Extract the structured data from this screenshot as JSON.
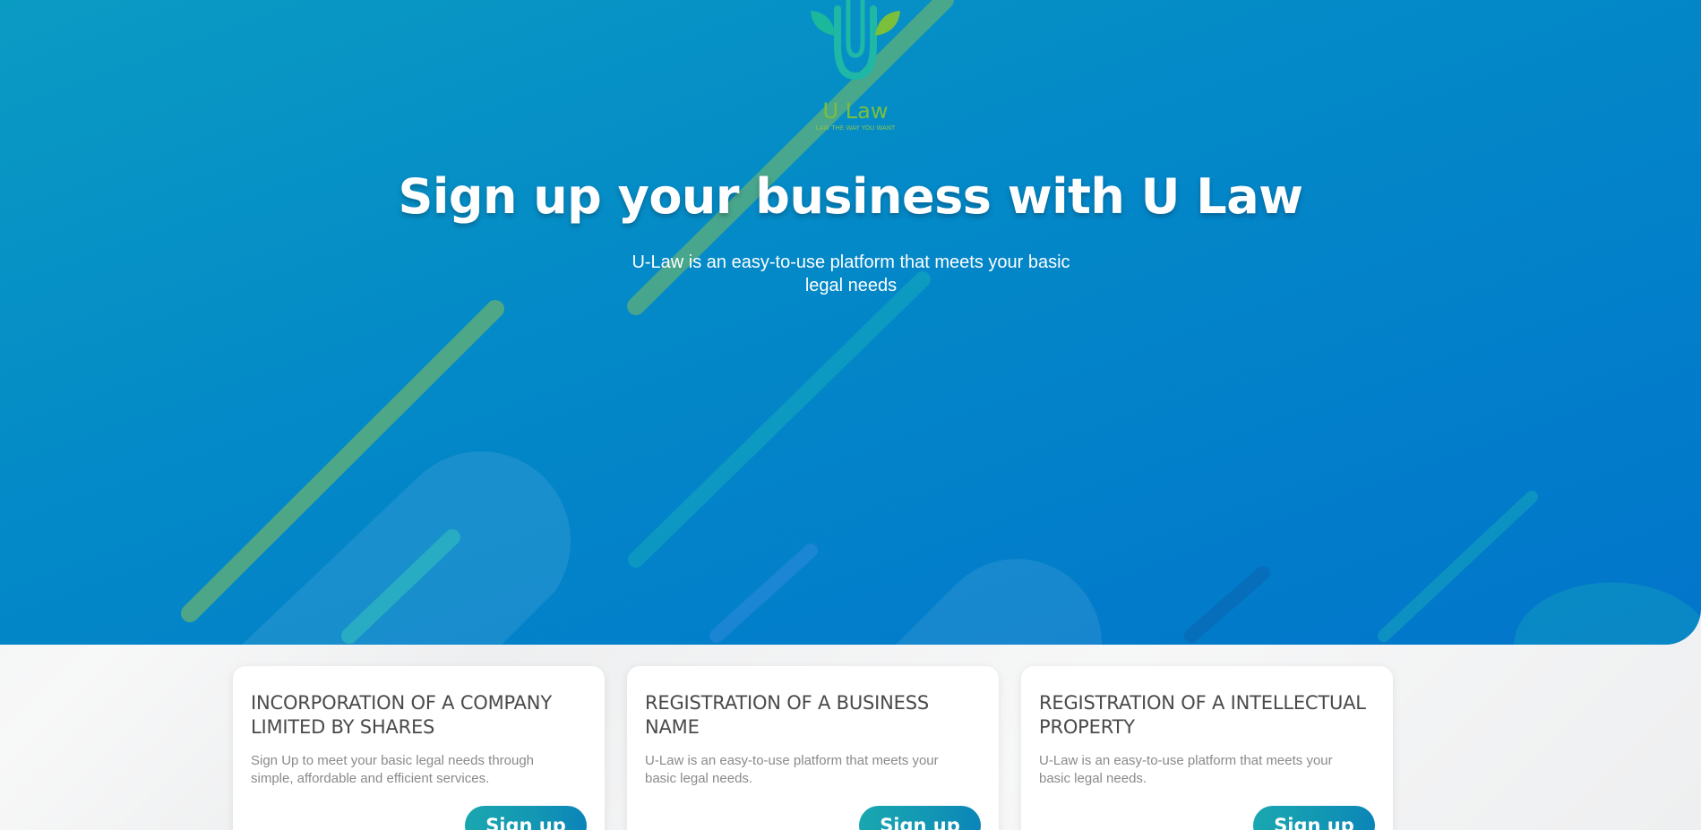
{
  "brand": {
    "logo_icon": "u-law-leaf-logo",
    "wordmark": "U Law",
    "tagline": "LAW THE WAY YOU WANT",
    "colors": {
      "hero_start": "#0a9bc3",
      "hero_end": "#0275cb",
      "leaf_green": "#7bbf3a",
      "teal": "#1aa7b0"
    }
  },
  "hero": {
    "title": "Sign up your business with U Law",
    "subtitle": "U-Law is an easy-to-use platform that meets your basic legal needs"
  },
  "cards": [
    {
      "title": "INCORPORATION OF A COMPANY LIMITED BY SHARES",
      "description": "Sign Up to meet your basic legal needs through simple, affordable and efficient services.",
      "button": "Sign up"
    },
    {
      "title": "REGISTRATION OF A BUSINESS NAME",
      "description": "U-Law is an easy-to-use platform that meets your basic legal needs.",
      "button": "Sign up"
    },
    {
      "title": "REGISTRATION OF A INTELLECTUAL PROPERTY",
      "description": "U-Law is an easy-to-use platform that meets your basic legal needs.",
      "button": "Sign up"
    }
  ]
}
